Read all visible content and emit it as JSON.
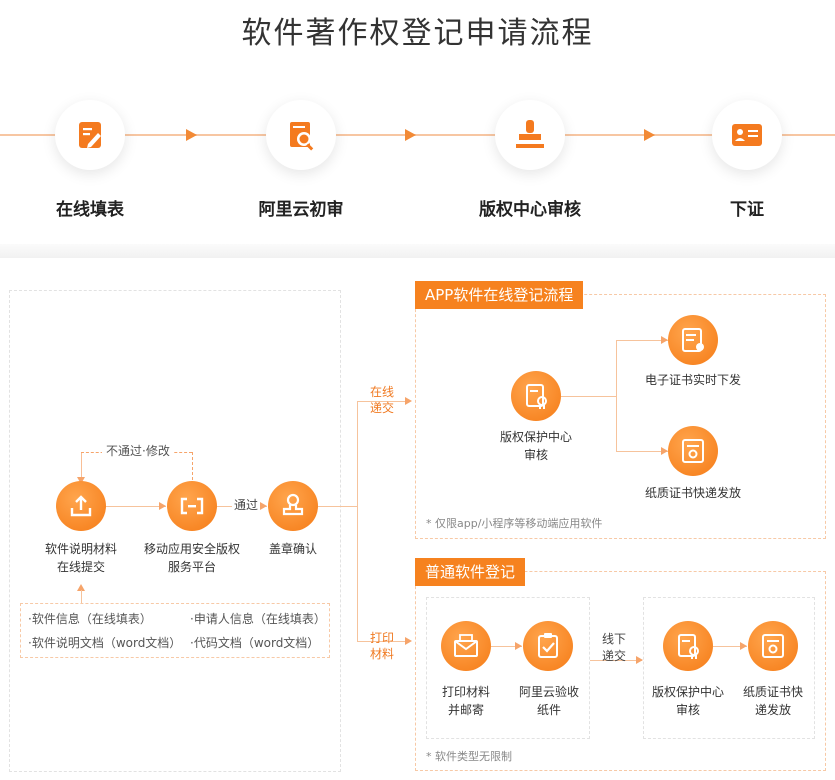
{
  "title": "软件著作权登记申请流程",
  "steps": [
    {
      "label": "在线填表",
      "icon": "edit-form-icon"
    },
    {
      "label": "阿里云初审",
      "icon": "document-search-icon"
    },
    {
      "label": "版权中心审核",
      "icon": "stamp-icon"
    },
    {
      "label": "下证",
      "icon": "id-card-icon"
    }
  ],
  "left": {
    "retry_label": "不通过·修改",
    "submit_label": "软件说明材料\n在线提交",
    "platform_label": "移动应用安全版权\n服务平台",
    "pass_label": "通过",
    "stamp_label": "盖章确认",
    "materials": [
      "·软件信息（在线填表）",
      "·申请人信息（在线填表）",
      "·软件说明文档（word文档）",
      "·代码文档（word文档）"
    ]
  },
  "branch": {
    "online_label": "在线\n递交",
    "print_label": "打印\n材料"
  },
  "app_flow": {
    "header": "APP软件在线登记流程",
    "center_label": "版权保护中心\n审核",
    "electronic_label": "电子证书实时下发",
    "paper_label": "纸质证书快递发放",
    "note": "* 仅限app/小程序等移动端应用软件"
  },
  "normal_flow": {
    "header": "普通软件登记",
    "print_mail_label": "打印材料\n并邮寄",
    "aliyun_receive_label": "阿里云验收\n纸件",
    "offline_label": "线下\n递交",
    "center_label": "版权保护中心\n审核",
    "paper_label": "纸质证书快\n递发放",
    "note": "* 软件类型无限制"
  },
  "colors": {
    "accent": "#f6821f",
    "line": "#f6c39c"
  }
}
